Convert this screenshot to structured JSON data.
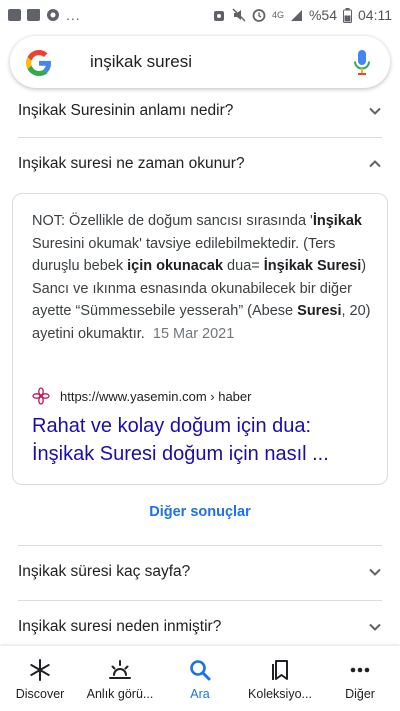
{
  "status_bar": {
    "left_more": "...",
    "network": "4G",
    "battery": "%54",
    "time": "04:11"
  },
  "search": {
    "query": "inşikak suresi"
  },
  "faq_top": {
    "q1": "Inşikak Suresinin anlamı nedir?",
    "q2": "Inşikak suresi ne zaman okunur?"
  },
  "answer": {
    "s1": "NOT: Özellikle de doğum sancısı sırasında '",
    "b1": "İnşikak",
    "s2": " Suresini okumak' tavsiye edilebilmektedir. (Ters duruşlu bebek ",
    "b2": "için okunacak",
    "s3": " dua= ",
    "b3": "İnşikak Suresi",
    "s4": ") Sancı ve ıkınma esnasında okunabilecek bir diğer ayette “Sümmessebile yesserah” (Abese ",
    "b4": "Suresi",
    "s5": ", 20) ayetini okumaktır.",
    "date": "15 Mar 2021",
    "source_url": "https://www.yasemin.com › haber",
    "title": "Rahat ve kolay doğum için dua: İnşikak Suresi doğum için nasıl ..."
  },
  "more_results": "Diğer sonuçlar",
  "faq_bottom": {
    "q3": "Inşikak süresi kaç sayfa?",
    "q4": "Inşikak suresi neden inmiştir?"
  },
  "bottom_nav": {
    "items": [
      {
        "label": "Discover",
        "icon": "asterisk-icon"
      },
      {
        "label": "Anlık görü...",
        "icon": "sunrise-icon"
      },
      {
        "label": "Ara",
        "icon": "search-icon"
      },
      {
        "label": "Koleksiyo...",
        "icon": "collections-icon"
      },
      {
        "label": "Diğer",
        "icon": "more-dots-icon"
      }
    ],
    "active_index": 2
  },
  "colors": {
    "link": "#1a0dab",
    "accent": "#1a73e8",
    "text": "#202124",
    "divider": "#dadce0"
  }
}
